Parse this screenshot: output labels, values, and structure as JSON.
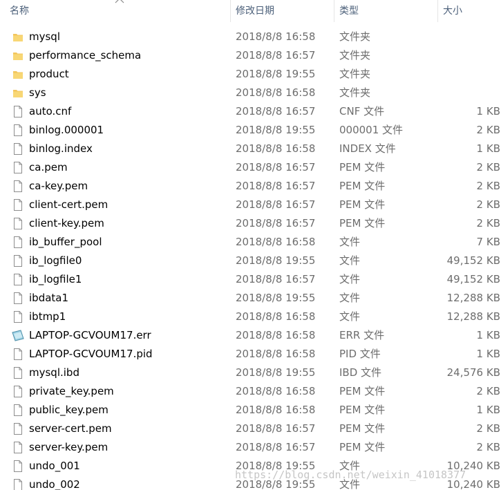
{
  "columns": {
    "name": "名称",
    "date": "修改日期",
    "type": "类型",
    "size": "大小"
  },
  "colors": {
    "header_text": "#4c607a",
    "folder": "#f2c55c",
    "secondary_text": "#6d6d6d"
  },
  "files": [
    {
      "name": "mysql",
      "date": "2018/8/8 16:58",
      "type": "文件夹",
      "size": "",
      "icon": "folder-icon"
    },
    {
      "name": "performance_schema",
      "date": "2018/8/8 16:57",
      "type": "文件夹",
      "size": "",
      "icon": "folder-icon"
    },
    {
      "name": "product",
      "date": "2018/8/8 19:55",
      "type": "文件夹",
      "size": "",
      "icon": "folder-icon"
    },
    {
      "name": "sys",
      "date": "2018/8/8 16:58",
      "type": "文件夹",
      "size": "",
      "icon": "folder-icon"
    },
    {
      "name": "auto.cnf",
      "date": "2018/8/8 16:57",
      "type": "CNF 文件",
      "size": "1 KB",
      "icon": "file-icon"
    },
    {
      "name": "binlog.000001",
      "date": "2018/8/8 19:55",
      "type": "000001 文件",
      "size": "2 KB",
      "icon": "file-icon"
    },
    {
      "name": "binlog.index",
      "date": "2018/8/8 16:58",
      "type": "INDEX 文件",
      "size": "1 KB",
      "icon": "file-icon"
    },
    {
      "name": "ca.pem",
      "date": "2018/8/8 16:57",
      "type": "PEM 文件",
      "size": "2 KB",
      "icon": "file-icon"
    },
    {
      "name": "ca-key.pem",
      "date": "2018/8/8 16:57",
      "type": "PEM 文件",
      "size": "2 KB",
      "icon": "file-icon"
    },
    {
      "name": "client-cert.pem",
      "date": "2018/8/8 16:57",
      "type": "PEM 文件",
      "size": "2 KB",
      "icon": "file-icon"
    },
    {
      "name": "client-key.pem",
      "date": "2018/8/8 16:57",
      "type": "PEM 文件",
      "size": "2 KB",
      "icon": "file-icon"
    },
    {
      "name": "ib_buffer_pool",
      "date": "2018/8/8 16:58",
      "type": "文件",
      "size": "7 KB",
      "icon": "file-icon"
    },
    {
      "name": "ib_logfile0",
      "date": "2018/8/8 19:55",
      "type": "文件",
      "size": "49,152 KB",
      "icon": "file-icon"
    },
    {
      "name": "ib_logfile1",
      "date": "2018/8/8 16:57",
      "type": "文件",
      "size": "49,152 KB",
      "icon": "file-icon"
    },
    {
      "name": "ibdata1",
      "date": "2018/8/8 19:55",
      "type": "文件",
      "size": "12,288 KB",
      "icon": "file-icon"
    },
    {
      "name": "ibtmp1",
      "date": "2018/8/8 16:58",
      "type": "文件",
      "size": "12,288 KB",
      "icon": "file-icon"
    },
    {
      "name": "LAPTOP-GCVOUM17.err",
      "date": "2018/8/8 16:58",
      "type": "ERR 文件",
      "size": "1 KB",
      "icon": "err-file-icon"
    },
    {
      "name": "LAPTOP-GCVOUM17.pid",
      "date": "2018/8/8 16:58",
      "type": "PID 文件",
      "size": "1 KB",
      "icon": "file-icon"
    },
    {
      "name": "mysql.ibd",
      "date": "2018/8/8 19:55",
      "type": "IBD 文件",
      "size": "24,576 KB",
      "icon": "file-icon"
    },
    {
      "name": "private_key.pem",
      "date": "2018/8/8 16:58",
      "type": "PEM 文件",
      "size": "2 KB",
      "icon": "file-icon"
    },
    {
      "name": "public_key.pem",
      "date": "2018/8/8 16:58",
      "type": "PEM 文件",
      "size": "1 KB",
      "icon": "file-icon"
    },
    {
      "name": "server-cert.pem",
      "date": "2018/8/8 16:57",
      "type": "PEM 文件",
      "size": "2 KB",
      "icon": "file-icon"
    },
    {
      "name": "server-key.pem",
      "date": "2018/8/8 16:57",
      "type": "PEM 文件",
      "size": "2 KB",
      "icon": "file-icon"
    },
    {
      "name": "undo_001",
      "date": "2018/8/8 19:55",
      "type": "文件",
      "size": "10,240 KB",
      "icon": "file-icon"
    },
    {
      "name": "undo_002",
      "date": "2018/8/8 19:55",
      "type": "文件",
      "size": "10,240 KB",
      "icon": "file-icon"
    }
  ],
  "watermark": "https://blog.csdn.net/weixin_41018377"
}
